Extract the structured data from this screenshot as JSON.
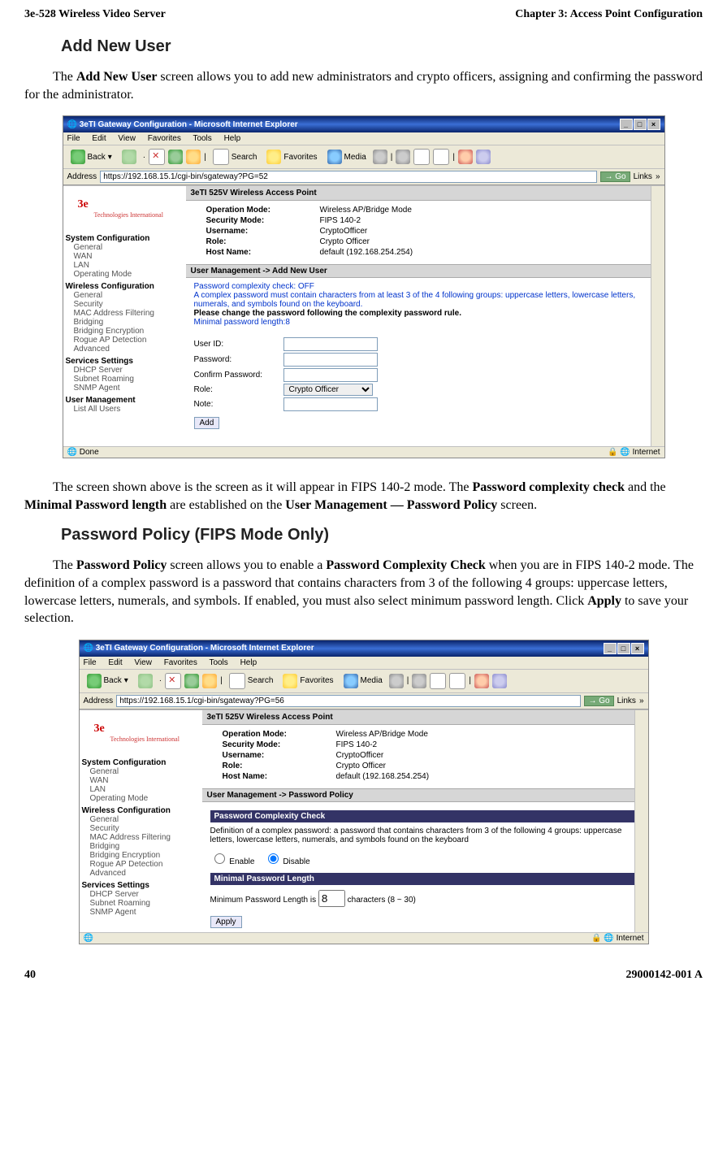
{
  "header": {
    "left": "3e-528 Wireless Video Server",
    "right": "Chapter 3: Access Point Configuration"
  },
  "section1": {
    "title": "Add New User"
  },
  "para1": {
    "pre": "The ",
    "b1": "Add New User",
    "post": " screen allows you to add new administrators and crypto officers, assigning and confirming the password for the administrator."
  },
  "shot1": {
    "title": "3eTI Gateway Configuration - Microsoft Internet Explorer",
    "menu": [
      "File",
      "Edit",
      "View",
      "Favorites",
      "Tools",
      "Help"
    ],
    "back": "Back",
    "search": "Search",
    "favorites": "Favorites",
    "media": "Media",
    "addrLabel": "Address",
    "url": "https://192.168.15.1/cgi-bin/sgateway?PG=52",
    "go": "Go",
    "links": "Links",
    "logo": "3e",
    "logoSub": "Technologies\nInternational",
    "nav": {
      "sys": "System Configuration",
      "sysItems": [
        "General",
        "WAN",
        "LAN",
        "Operating Mode"
      ],
      "wl": "Wireless Configuration",
      "wlItems": [
        "General",
        "Security",
        "MAC Address Filtering",
        "Bridging",
        "Bridging Encryption",
        "Rogue AP Detection",
        "Advanced"
      ],
      "svc": "Services Settings",
      "svcItems": [
        "DHCP Server",
        "Subnet Roaming",
        "SNMP Agent"
      ],
      "um": "User Management",
      "umItems": [
        "List All Users"
      ]
    },
    "apTitle": "3eTI 525V Wireless Access Point",
    "info": [
      {
        "l": "Operation Mode:",
        "v": "Wireless AP/Bridge Mode"
      },
      {
        "l": "Security Mode:",
        "v": "FIPS 140-2"
      },
      {
        "l": "Username:",
        "v": "CryptoOfficer"
      },
      {
        "l": "Role:",
        "v": "Crypto Officer"
      },
      {
        "l": "Host Name:",
        "v": "default (192.168.254.254)"
      }
    ],
    "secBar": "User Management -> Add New User",
    "pcc": "Password complexity check: OFF",
    "complexMsg": "A complex password must contain characters from at least 3 of the 4 following groups: uppercase letters, lowercase letters, numerals, and symbols found on the keyboard.",
    "changeMsg": "Please change the password following the complexity password rule.",
    "minLen": "Minimal password length:8",
    "fields": {
      "uid": "User ID:",
      "pwd": "Password:",
      "cpwd": "Confirm Password:",
      "role": "Role:",
      "roleVal": "Crypto Officer",
      "note": "Note:"
    },
    "add": "Add",
    "statusLeft": "Done",
    "statusRight": "Internet"
  },
  "para2": {
    "t1": "The screen shown above is the screen as it will appear in FIPS 140-2 mode. The ",
    "b1": "Password complexity check",
    "t2": " and the ",
    "b2": "Minimal Password length",
    "t3": " are established on the ",
    "b3": "User Management — Password Policy",
    "t4": " screen."
  },
  "section2": {
    "title": "Password Policy (FIPS Mode Only)"
  },
  "para3": {
    "t1": "The ",
    "b1": "Password Policy",
    "t2": " screen allows you to enable a ",
    "b2": "Password Complexity Check",
    "t3": " when you are in FIPS 140-2 mode. The definition of a complex password is a password that contains characters from 3 of the following 4 groups: uppercase letters, lowercase letters, numerals, and symbols. If enabled, you must also select minimum password length. Click ",
    "b3": "Apply",
    "t4": " to save your selection."
  },
  "shot2": {
    "title": "3eTI Gateway Configuration - Microsoft Internet Explorer",
    "url": "https://192.168.15.1/cgi-bin/sgateway?PG=56",
    "secBar": "User Management -> Password Policy",
    "pcc": "Password Complexity Check",
    "defMsg": "Definition of a complex password: a password that contains characters from 3 of the following 4 groups: uppercase letters, lowercase letters, numerals, and symbols found on the keyboard",
    "enable": "Enable",
    "disable": "Disable",
    "mpl": "Minimal Password Length",
    "mplText1": "Minimum Password Length is ",
    "mplVal": "8",
    "mplText2": " characters (8 ~ 30)",
    "apply": "Apply",
    "statusRight": "Internet"
  },
  "footer": {
    "left": "40",
    "right": "29000142-001 A"
  }
}
